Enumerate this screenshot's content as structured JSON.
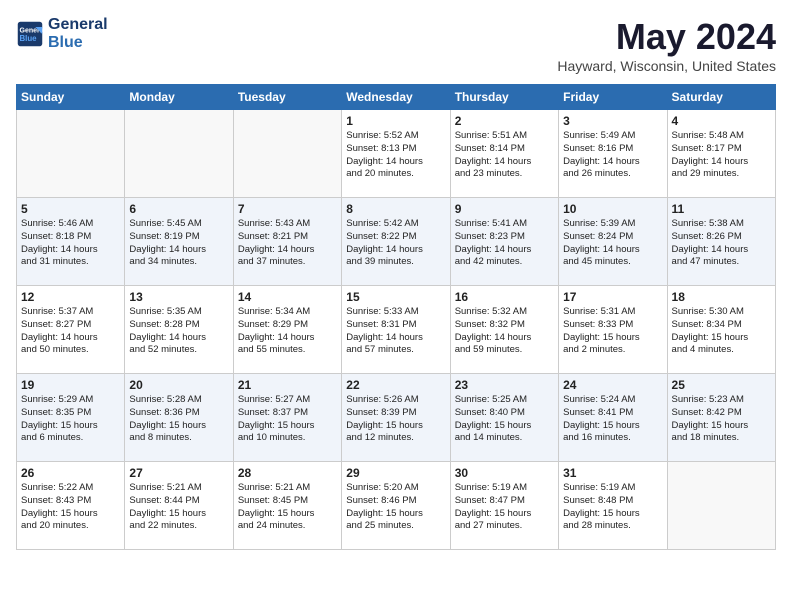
{
  "header": {
    "logo_line1": "General",
    "logo_line2": "Blue",
    "month_title": "May 2024",
    "location": "Hayward, Wisconsin, United States"
  },
  "days_of_week": [
    "Sunday",
    "Monday",
    "Tuesday",
    "Wednesday",
    "Thursday",
    "Friday",
    "Saturday"
  ],
  "weeks": [
    [
      {
        "day": "",
        "text": ""
      },
      {
        "day": "",
        "text": ""
      },
      {
        "day": "",
        "text": ""
      },
      {
        "day": "1",
        "text": "Sunrise: 5:52 AM\nSunset: 8:13 PM\nDaylight: 14 hours\nand 20 minutes."
      },
      {
        "day": "2",
        "text": "Sunrise: 5:51 AM\nSunset: 8:14 PM\nDaylight: 14 hours\nand 23 minutes."
      },
      {
        "day": "3",
        "text": "Sunrise: 5:49 AM\nSunset: 8:16 PM\nDaylight: 14 hours\nand 26 minutes."
      },
      {
        "day": "4",
        "text": "Sunrise: 5:48 AM\nSunset: 8:17 PM\nDaylight: 14 hours\nand 29 minutes."
      }
    ],
    [
      {
        "day": "5",
        "text": "Sunrise: 5:46 AM\nSunset: 8:18 PM\nDaylight: 14 hours\nand 31 minutes."
      },
      {
        "day": "6",
        "text": "Sunrise: 5:45 AM\nSunset: 8:19 PM\nDaylight: 14 hours\nand 34 minutes."
      },
      {
        "day": "7",
        "text": "Sunrise: 5:43 AM\nSunset: 8:21 PM\nDaylight: 14 hours\nand 37 minutes."
      },
      {
        "day": "8",
        "text": "Sunrise: 5:42 AM\nSunset: 8:22 PM\nDaylight: 14 hours\nand 39 minutes."
      },
      {
        "day": "9",
        "text": "Sunrise: 5:41 AM\nSunset: 8:23 PM\nDaylight: 14 hours\nand 42 minutes."
      },
      {
        "day": "10",
        "text": "Sunrise: 5:39 AM\nSunset: 8:24 PM\nDaylight: 14 hours\nand 45 minutes."
      },
      {
        "day": "11",
        "text": "Sunrise: 5:38 AM\nSunset: 8:26 PM\nDaylight: 14 hours\nand 47 minutes."
      }
    ],
    [
      {
        "day": "12",
        "text": "Sunrise: 5:37 AM\nSunset: 8:27 PM\nDaylight: 14 hours\nand 50 minutes."
      },
      {
        "day": "13",
        "text": "Sunrise: 5:35 AM\nSunset: 8:28 PM\nDaylight: 14 hours\nand 52 minutes."
      },
      {
        "day": "14",
        "text": "Sunrise: 5:34 AM\nSunset: 8:29 PM\nDaylight: 14 hours\nand 55 minutes."
      },
      {
        "day": "15",
        "text": "Sunrise: 5:33 AM\nSunset: 8:31 PM\nDaylight: 14 hours\nand 57 minutes."
      },
      {
        "day": "16",
        "text": "Sunrise: 5:32 AM\nSunset: 8:32 PM\nDaylight: 14 hours\nand 59 minutes."
      },
      {
        "day": "17",
        "text": "Sunrise: 5:31 AM\nSunset: 8:33 PM\nDaylight: 15 hours\nand 2 minutes."
      },
      {
        "day": "18",
        "text": "Sunrise: 5:30 AM\nSunset: 8:34 PM\nDaylight: 15 hours\nand 4 minutes."
      }
    ],
    [
      {
        "day": "19",
        "text": "Sunrise: 5:29 AM\nSunset: 8:35 PM\nDaylight: 15 hours\nand 6 minutes."
      },
      {
        "day": "20",
        "text": "Sunrise: 5:28 AM\nSunset: 8:36 PM\nDaylight: 15 hours\nand 8 minutes."
      },
      {
        "day": "21",
        "text": "Sunrise: 5:27 AM\nSunset: 8:37 PM\nDaylight: 15 hours\nand 10 minutes."
      },
      {
        "day": "22",
        "text": "Sunrise: 5:26 AM\nSunset: 8:39 PM\nDaylight: 15 hours\nand 12 minutes."
      },
      {
        "day": "23",
        "text": "Sunrise: 5:25 AM\nSunset: 8:40 PM\nDaylight: 15 hours\nand 14 minutes."
      },
      {
        "day": "24",
        "text": "Sunrise: 5:24 AM\nSunset: 8:41 PM\nDaylight: 15 hours\nand 16 minutes."
      },
      {
        "day": "25",
        "text": "Sunrise: 5:23 AM\nSunset: 8:42 PM\nDaylight: 15 hours\nand 18 minutes."
      }
    ],
    [
      {
        "day": "26",
        "text": "Sunrise: 5:22 AM\nSunset: 8:43 PM\nDaylight: 15 hours\nand 20 minutes."
      },
      {
        "day": "27",
        "text": "Sunrise: 5:21 AM\nSunset: 8:44 PM\nDaylight: 15 hours\nand 22 minutes."
      },
      {
        "day": "28",
        "text": "Sunrise: 5:21 AM\nSunset: 8:45 PM\nDaylight: 15 hours\nand 24 minutes."
      },
      {
        "day": "29",
        "text": "Sunrise: 5:20 AM\nSunset: 8:46 PM\nDaylight: 15 hours\nand 25 minutes."
      },
      {
        "day": "30",
        "text": "Sunrise: 5:19 AM\nSunset: 8:47 PM\nDaylight: 15 hours\nand 27 minutes."
      },
      {
        "day": "31",
        "text": "Sunrise: 5:19 AM\nSunset: 8:48 PM\nDaylight: 15 hours\nand 28 minutes."
      },
      {
        "day": "",
        "text": ""
      }
    ]
  ]
}
